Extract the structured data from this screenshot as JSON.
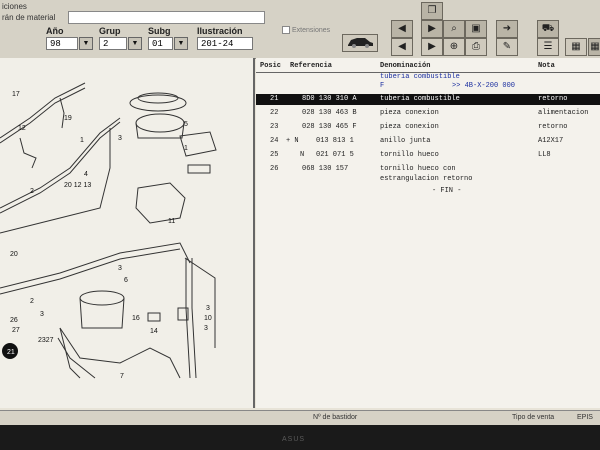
{
  "topbar": {
    "label1": "iciones",
    "label2": "rán de material"
  },
  "selectors": [
    {
      "label": "Año",
      "value": "98"
    },
    {
      "label": "Grup",
      "value": "2"
    },
    {
      "label": "Subg",
      "value": "01"
    },
    {
      "label": "Ilustración",
      "value": "201-24"
    }
  ],
  "checkbox": {
    "label": "Extensiones"
  },
  "toolbar_icons": [
    "car-icon",
    "arrow-left-icon",
    "arrow-right-icon",
    "search-icon",
    "printer-icon",
    "edit-icon",
    "list-icon",
    "grid-icon"
  ],
  "table": {
    "columns": [
      "Posic",
      "Referencia",
      "Denominación",
      "Nota"
    ],
    "header_title": "tuberia combustible",
    "header_prefix": "F",
    "header_range": ">> 4B-X-200 000",
    "rows": [
      {
        "pos": "21",
        "mark": "",
        "ref": "8D0 130 310 A",
        "desc": "tuberia combustible",
        "note": "retorno",
        "selected": true
      },
      {
        "pos": "22",
        "mark": "",
        "ref": "028 130 463 B",
        "desc": "pieza conexion",
        "note": "alimentacion",
        "selected": false
      },
      {
        "pos": "23",
        "mark": "",
        "ref": "028 130 465 F",
        "desc": "pieza conexion",
        "note": "retorno",
        "selected": false
      },
      {
        "pos": "24",
        "mark": "+ N",
        "ref": "013 813 1",
        "desc": "anillo junta",
        "note": "A12X17",
        "selected": false
      },
      {
        "pos": "25",
        "mark": "N",
        "ref": "021 071 5",
        "desc": "tornillo hueco",
        "note": "LL8",
        "selected": false
      },
      {
        "pos": "26",
        "mark": "",
        "ref": "068 130 157",
        "desc": "tornillo hueco con",
        "note": "",
        "selected": false
      }
    ],
    "continuation": "estrangulacion retorno",
    "fin": "- FIN -"
  },
  "status": {
    "field1": "Nº de bastidor",
    "field2": "Tipo de venta",
    "field3": "EPIS"
  },
  "bezel": {
    "logo": "ASUS"
  },
  "diagram_labels": [
    "17",
    "19",
    "12",
    "2",
    "3",
    "20",
    "12",
    "13",
    "1",
    "4",
    "20",
    "3",
    "2",
    "3",
    "26",
    "27",
    "22",
    "23",
    "21",
    "7",
    "5",
    "1",
    "11",
    "6",
    "16",
    "14",
    "3",
    "10",
    "3"
  ]
}
